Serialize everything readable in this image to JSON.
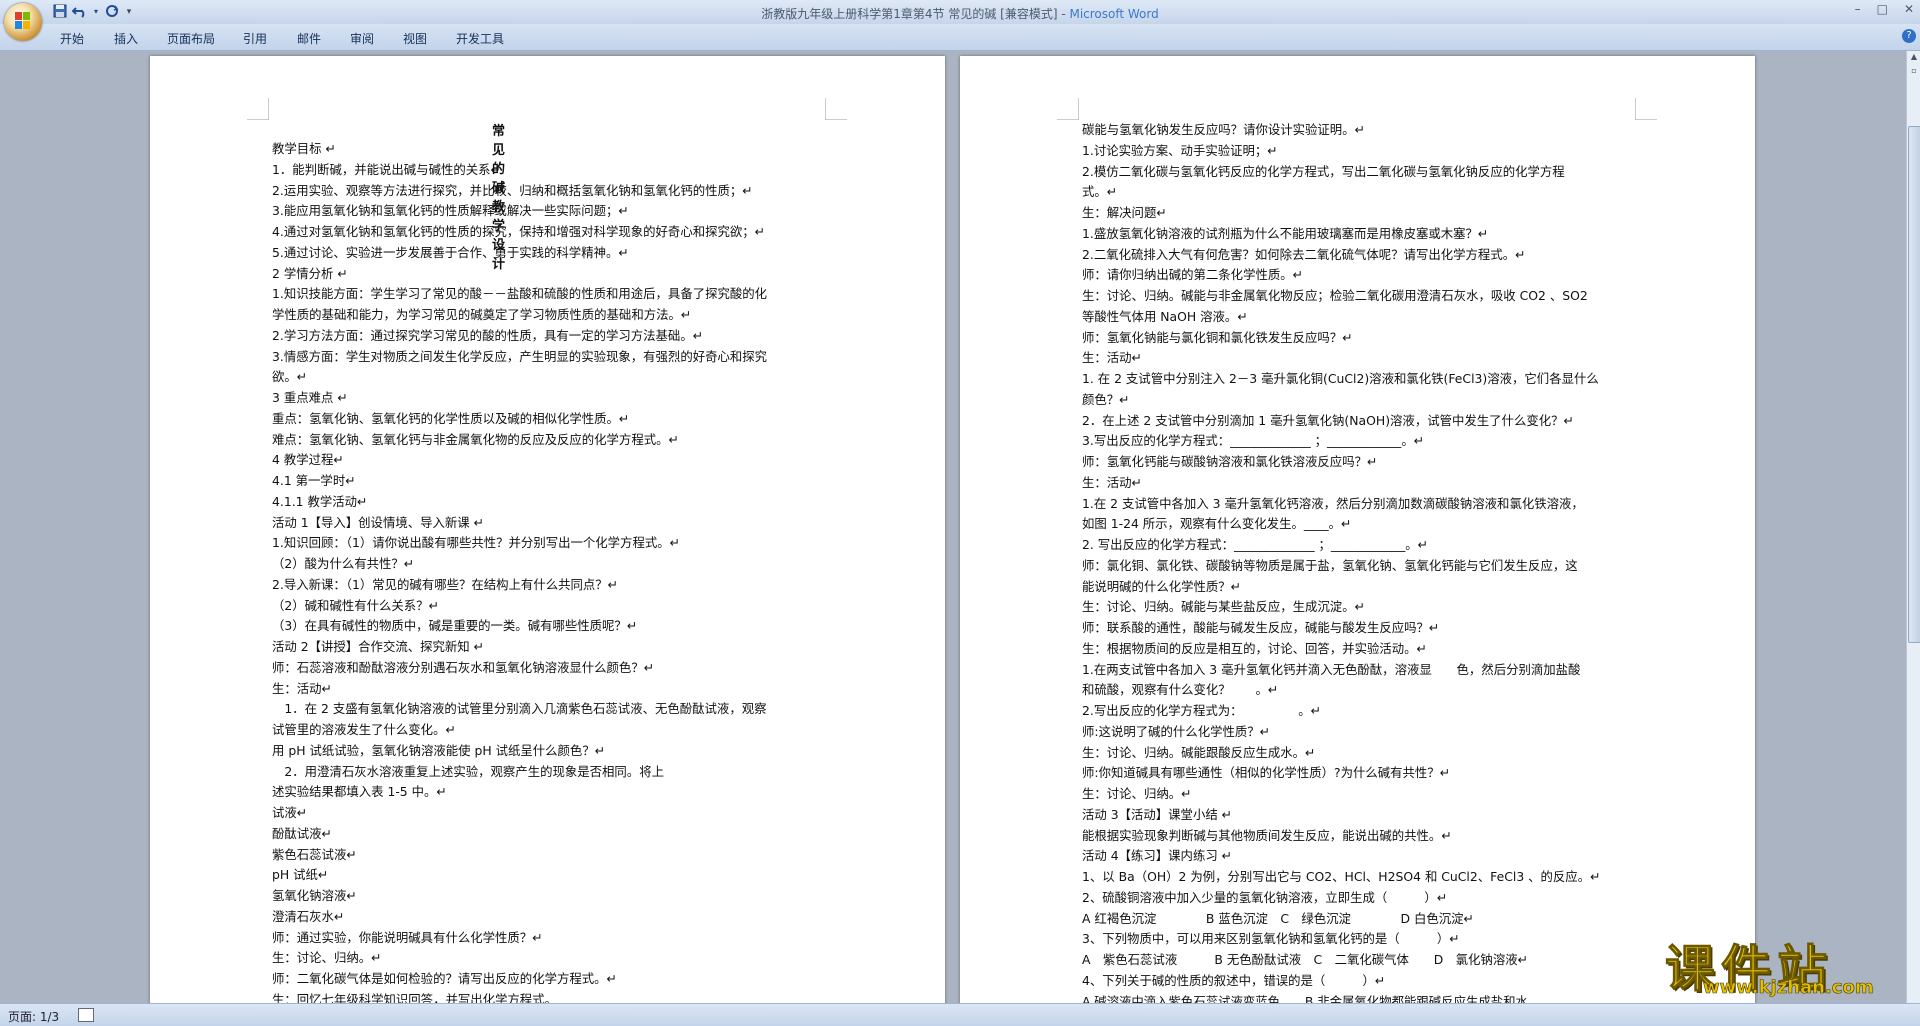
{
  "window": {
    "title": "浙教版九年级上册科学第1章第4节 常见的碱 [兼容模式]",
    "app_name": "Microsoft Word",
    "controls": [
      "–",
      "□",
      "✕"
    ]
  },
  "ribbon": {
    "tabs": [
      "开始",
      "插入",
      "页面布局",
      "引用",
      "邮件",
      "审阅",
      "视图",
      "开发工具"
    ],
    "help_label": "?"
  },
  "page1": {
    "title": "常见的碱教学设计",
    "lines": [
      "教学目标 ↵",
      "1．能判断碱，并能说出碱与碱性的关系↵",
      "2.运用实验、观察等方法进行探究，并比较、归纳和概括氢氧化钠和氢氧化钙的性质；↵",
      "3.能应用氢氧化钠和氢氧化钙的性质解释或解决一些实际问题；↵",
      "4.通过对氢氧化钠和氢氧化钙的性质的探究，保持和增强对科学现象的好奇心和探究欲；↵",
      "5.通过讨论、实验进一步发展善于合作、勇于实践的科学精神。↵",
      "2 学情分析 ↵",
      "1.知识技能方面：学生学习了常见的酸－－盐酸和硫酸的性质和用途后，具备了探究酸的化",
      "学性质的基础和能力，为学习常见的碱奠定了学习物质性质的基础和方法。↵",
      "2.学习方法方面：通过探究学习常见的酸的性质，具有一定的学习方法基础。↵",
      "3.情感方面：学生对物质之间发生化学反应，产生明显的实验现象，有强烈的好奇心和探究",
      "欲。↵",
      "3 重点难点 ↵",
      "重点：氢氧化钠、氢氧化钙的化学性质以及碱的相似化学性质。↵",
      "难点：氢氧化钠、氢氧化钙与非金属氧化物的反应及反应的化学方程式。↵",
      "4 教学过程↵",
      "4.1 第一学时↵",
      "4.1.1 教学活动↵",
      "活动 1【导入】创设情境、导入新课 ↵",
      "1.知识回顾：（1）请你说出酸有哪些共性？并分别写出一个化学方程式。↵",
      "（2）酸为什么有共性？↵",
      "2.导入新课：（1）常见的碱有哪些？在结构上有什么共同点？↵",
      "（2）碱和碱性有什么关系？↵",
      "（3）在具有碱性的物质中，碱是重要的一类。碱有哪些性质呢？↵",
      "活动 2【讲授】合作交流、探究新知 ↵",
      "师：石蕊溶液和酚酞溶液分别遇石灰水和氢氧化钠溶液显什么颜色？↵",
      "生：活动↵",
      "　1．在 2 支盛有氢氧化钠溶液的试管里分别滴入几滴紫色石蕊试液、无色酚酞试液，观察",
      "试管里的溶液发生了什么变化。↵",
      "用 pH 试纸试验，氢氧化钠溶液能使 pH 试纸呈什么颜色？↵",
      "　2．用澄清石灰水溶液重复上述实验，观察产生的现象是否相同。将上",
      "述实验结果都填入表 1-5 中。↵",
      "试液↵",
      "酚酞试液↵",
      "紫色石蕊试液↵",
      "pH 试纸↵",
      "氢氧化钠溶液↵",
      "澄清石灰水↵",
      "师：通过实验，你能说明碱具有什么化学性质？↵",
      "生：讨论、归纳。↵",
      "师：二氧化碳气体是如何检验的？请写出反应的化学方程式。↵",
      "生：回忆七年级科学知识回答，并写出化学方程式。"
    ]
  },
  "page2": {
    "lines": [
      "碳能与氢氧化钠发生反应吗？请你设计实验证明。↵",
      "1.讨论实验方案、动手实验证明；↵",
      "2.模仿二氧化碳与氢氧化钙反应的化学方程式，写出二氧化碳与氢氧化钠反应的化学方程",
      "式。↵",
      "生：解决问题↵",
      "1.盛放氢氧化钠溶液的试剂瓶为什么不能用玻璃塞而是用橡皮塞或木塞？↵",
      "2.二氧化硫排入大气有何危害？如何除去二氧化硫气体呢？请写出化学方程式。↵",
      "师：请你归纳出碱的第二条化学性质。↵",
      "生：讨论、归纳。碱能与非金属氧化物反应；检验二氧化碳用澄清石灰水，吸收 CO2 、SO2",
      "等酸性气体用 NaOH 溶液。↵",
      "师：氢氧化钠能与氯化铜和氯化铁发生反应吗？↵",
      "生：活动↵",
      "1. 在 2 支试管中分别注入 2－3 毫升氯化铜(CuCl2)溶液和氯化铁(FeCl3)溶液，它们各显什么",
      "颜色？↵",
      "2．在上述 2 支试管中分别滴加 1 毫升氢氧化钠(NaOH)溶液，试管中发生了什么变化？↵",
      "3.写出反应的化学方程式：_____________ ；____________。↵",
      "师：氢氧化钙能与碳酸钠溶液和氯化铁溶液反应吗？↵",
      "生：活动↵",
      "1.在 2 支试管中各加入 3 毫升氢氧化钙溶液，然后分别滴加数滴碳酸钠溶液和氯化铁溶液，",
      "如图 1-24 所示，观察有什么变化发生。____。↵",
      "2. 写出反应的化学方程式：_____________ ；____________。↵",
      "师：氯化铜、氯化铁、碳酸钠等物质是属于盐，氢氧化钠、氢氧化钙能与它们发生反应，这",
      "能说明碱的什么化学性质？↵",
      "生：讨论、归纳。碱能与某些盐反应，生成沉淀。↵",
      "师：联系酸的通性，酸能与碱发生反应，碱能与酸发生反应吗？↵",
      "生：根据物质间的反应是相互的，讨论、回答，并实验活动。↵",
      "1.在两支试管中各加入 3 毫升氢氧化钙并滴入无色酚酞，溶液显　　色，然后分别滴加盐酸",
      "和硫酸，观察有什么变化？　　。↵",
      "2.写出反应的化学方程式为：　　　　　。↵",
      "师:这说明了碱的什么化学性质？↵",
      "生：讨论、归纳。碱能跟酸反应生成水。↵",
      "师:你知道碱具有哪些通性（相似的化学性质）?为什么碱有共性？↵",
      "生：讨论、归纳。↵",
      "活动 3【活动】课堂小结 ↵",
      "能根据实验现象判断碱与其他物质间发生反应，能说出碱的共性。↵",
      "活动 4【练习】课内练习 ↵",
      "1、以 Ba（OH）2 为例，分别写出它与 CO2、HCl、H2SO4 和 CuCl2、FeCl3 、的反应。↵",
      "2、硫酸铜溶液中加入少量的氢氧化钠溶液，立即生成（　　　）↵",
      "A 红褐色沉淀　　　　B 蓝色沉淀　C　绿色沉淀　　　　D 白色沉淀↵",
      "3、下列物质中，可以用来区别氢氧化钠和氢氧化钙的是（　　　）↵",
      "A　紫色石蕊试液　　　B 无色酚酞试液　C　二氧化碳气体　　D　氯化钠溶液↵",
      "4、下列关于碱的性质的叙述中，错误的是（　　　）↵",
      "A.碱溶液中滴入紫色石蕊试液变蓝色　　B.非金属氧化物都能跟碱反应生成盐和水"
    ]
  },
  "statusbar": {
    "page_info": "页面: 1/3"
  },
  "watermark": {
    "text": "课件站",
    "url": "www.kjzhan.com"
  },
  "colors": {
    "chrome_bg": "#c6d5ea",
    "workspace_bg": "#aab4c2",
    "watermark": "#e5c000"
  }
}
